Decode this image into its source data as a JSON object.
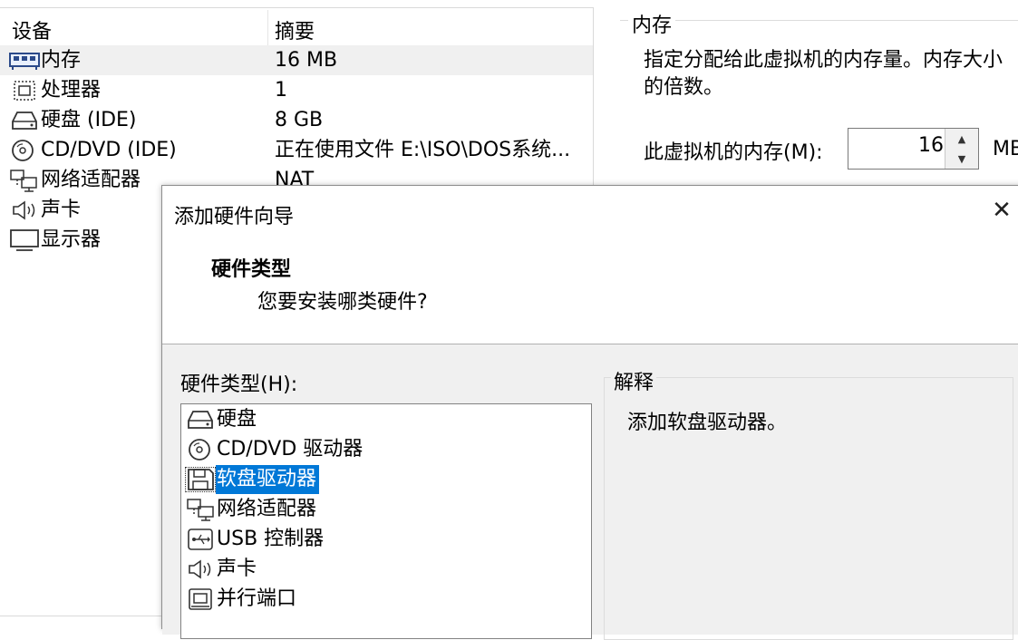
{
  "devices": {
    "col_device": "设备",
    "col_summary": "摘要",
    "rows": [
      {
        "name": "内存",
        "summary": "16 MB",
        "icon": "memory-icon"
      },
      {
        "name": "处理器",
        "summary": "1",
        "icon": "processor-icon"
      },
      {
        "name": "硬盘 (IDE)",
        "summary": "8 GB",
        "icon": "hard-disk-icon"
      },
      {
        "name": "CD/DVD (IDE)",
        "summary": "正在使用文件 E:\\ISO\\DOS系统...",
        "icon": "cd-dvd-icon"
      },
      {
        "name": "网络适配器",
        "summary": "NAT",
        "icon": "network-adapter-icon"
      },
      {
        "name": "声卡",
        "summary": "",
        "icon": "sound-card-icon"
      },
      {
        "name": "显示器",
        "summary": "",
        "icon": "display-icon"
      }
    ]
  },
  "memory": {
    "title": "内存",
    "desc_line1": "指定分配给此虚拟机的内存量。内存大小",
    "desc_line2": "的倍数。",
    "label": "此虚拟机的内存(M):",
    "value": "16",
    "unit": "MB"
  },
  "dialog": {
    "title": "添加硬件向导",
    "close": "✕",
    "header_title": "硬件类型",
    "header_subtitle": "您要安装哪类硬件?",
    "list_label": "硬件类型(H):",
    "items": [
      {
        "label": "硬盘",
        "icon": "hard-disk-icon"
      },
      {
        "label": "CD/DVD 驱动器",
        "icon": "cd-dvd-icon"
      },
      {
        "label": "软盘驱动器",
        "icon": "floppy-icon"
      },
      {
        "label": "网络适配器",
        "icon": "network-adapter-icon"
      },
      {
        "label": "USB 控制器",
        "icon": "usb-icon"
      },
      {
        "label": "声卡",
        "icon": "sound-card-icon"
      },
      {
        "label": "并行端口",
        "icon": "parallel-port-icon"
      }
    ],
    "selected_index": 2,
    "explanation_title": "解释",
    "explanation_text": "添加软盘驱动器。"
  },
  "colors": {
    "selection": "#0078d7",
    "row_highlight": "#f0f0f0"
  }
}
